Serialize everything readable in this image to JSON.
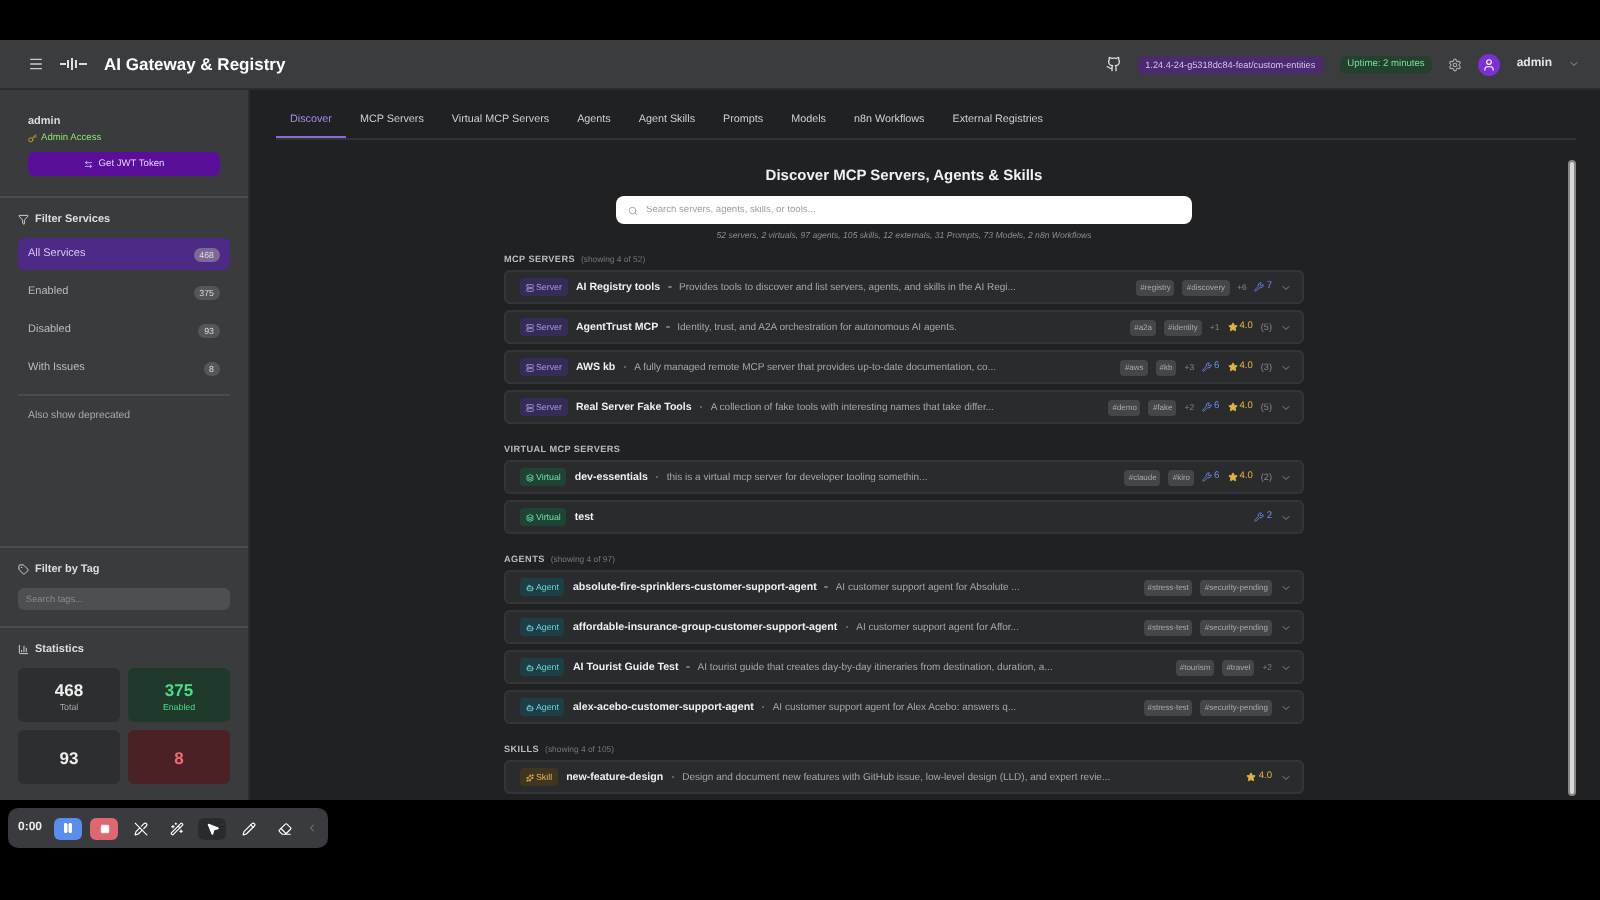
{
  "header": {
    "title": "AI Gateway & Registry",
    "version": "1.24.4-24-g5318dc84-feat/custom-entities",
    "uptime": "Uptime: 2 minutes",
    "user": "admin"
  },
  "sidebar": {
    "user": "admin",
    "role": "Admin Access",
    "token_button": "Get JWT Token",
    "filter_title": "Filter Services",
    "filters": [
      {
        "label": "All Services",
        "count": "468",
        "selected": true
      },
      {
        "label": "Enabled",
        "count": "375",
        "selected": false
      },
      {
        "label": "Disabled",
        "count": "93",
        "selected": false
      },
      {
        "label": "With Issues",
        "count": "8",
        "selected": false
      }
    ],
    "deprecated": "Also show deprecated",
    "tag_title": "Filter by Tag",
    "tag_placeholder": "Search tags...",
    "stats_title": "Statistics",
    "stats": [
      {
        "value": "468",
        "label": "Total",
        "color": "#2d2e30"
      },
      {
        "value": "375",
        "label": "Enabled",
        "color": "#1f3a2b"
      },
      {
        "value": "93",
        "color": "#2d2e30"
      },
      {
        "value": "8",
        "color": "#4a2226"
      }
    ]
  },
  "tabs": [
    {
      "label": "Discover",
      "selected": true
    },
    {
      "label": "MCP Servers",
      "selected": false
    },
    {
      "label": "Virtual MCP Servers",
      "selected": false
    },
    {
      "label": "Agents",
      "selected": false
    },
    {
      "label": "Agent Skills",
      "selected": false
    },
    {
      "label": "Prompts",
      "selected": false
    },
    {
      "label": "Models",
      "selected": false
    },
    {
      "label": "n8n Workflows",
      "selected": false
    },
    {
      "label": "External Registries",
      "selected": false
    }
  ],
  "discover": {
    "title": "Discover MCP Servers, Agents & Skills",
    "search_placeholder": "Search servers, agents, skills, or tools...",
    "summary": "52 servers, 2 virtuals, 97 agents, 105 skills, 12 externals, 31 Prompts, 73 Models, 2 n8n Workflows",
    "sections": [
      {
        "title": "MCP SERVERS",
        "note": "(showing 4 of 52)",
        "items": [
          {
            "kind": "server",
            "badge": "Server",
            "name": "AI Registry tools",
            "description": "Provides tools to discover and list servers, agents, and skills in the AI Regi...",
            "tags": [
              "#registry",
              "#discovery"
            ],
            "more": "+6",
            "tools": "7"
          },
          {
            "kind": "server",
            "badge": "Server",
            "name": "AgentTrust MCP",
            "description": "Identity, trust, and A2A orchestration for autonomous AI agents.",
            "tags": [
              "#a2a",
              "#identity"
            ],
            "more": "+1",
            "rating": "4.0",
            "reviews": "(5)"
          },
          {
            "kind": "server",
            "badge": "Server",
            "name": "AWS kb",
            "description": "A fully managed remote MCP server that provides up-to-date documentation, co...",
            "tags": [
              "#aws",
              "#kb"
            ],
            "more": "+3",
            "tools": "6",
            "rating": "4.0",
            "reviews": "(3)"
          },
          {
            "kind": "server",
            "badge": "Server",
            "name": "Real Server Fake Tools",
            "description": "A collection of fake tools with interesting names that take differ...",
            "tags": [
              "#demo",
              "#fake"
            ],
            "more": "+2",
            "tools": "6",
            "rating": "4.0",
            "reviews": "(5)"
          }
        ]
      },
      {
        "title": "VIRTUAL MCP SERVERS",
        "items": [
          {
            "kind": "virtual",
            "badge": "Virtual",
            "name": "dev-essentials",
            "description": "this is a virtual mcp server for developer tooling somethin...",
            "tags": [
              "#claude",
              "#kiro"
            ],
            "tools": "6",
            "rating": "4.0",
            "reviews": "(2)"
          },
          {
            "kind": "virtual",
            "badge": "Virtual",
            "name": "test",
            "tools": "2"
          }
        ]
      },
      {
        "title": "AGENTS",
        "note": "(showing 4 of 97)",
        "items": [
          {
            "kind": "agent",
            "badge": "Agent",
            "name": "absolute-fire-sprinklers-customer-support-agent",
            "description": "AI customer support agent for Absolute ...",
            "tags": [
              "#stress-test",
              "#security-pending"
            ]
          },
          {
            "kind": "agent",
            "badge": "Agent",
            "name": "affordable-insurance-group-customer-support-agent",
            "description": "AI customer support agent for Affor...",
            "tags": [
              "#stress-test",
              "#security-pending"
            ]
          },
          {
            "kind": "agent",
            "badge": "Agent",
            "name": "AI Tourist Guide Test",
            "description": "AI tourist guide that creates day-by-day itineraries from destination, duration, a...",
            "tags": [
              "#tourism",
              "#travel"
            ],
            "more": "+2"
          },
          {
            "kind": "agent",
            "badge": "Agent",
            "name": "alex-acebo-customer-support-agent",
            "description": "AI customer support agent for Alex Acebo: answers q...",
            "tags": [
              "#stress-test",
              "#security-pending"
            ]
          }
        ]
      },
      {
        "title": "SKILLS",
        "note": "(showing 4 of 105)",
        "items": [
          {
            "kind": "skill",
            "badge": "Skill",
            "name": "new-feature-design",
            "description": "Design and document new features with GitHub issue, low-level design (LLD), and expert revie...",
            "rating": "4.0"
          }
        ]
      }
    ]
  },
  "recorder": {
    "time": "0:00"
  }
}
